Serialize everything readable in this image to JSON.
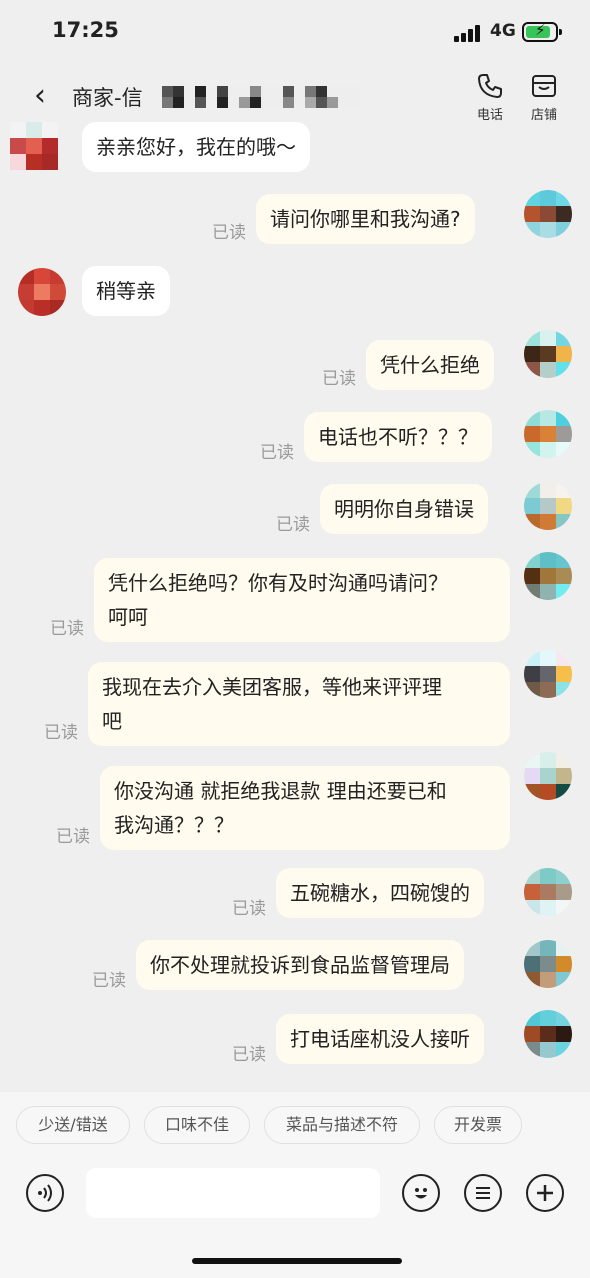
{
  "status": {
    "time": "17:25",
    "network": "4G"
  },
  "header": {
    "back_icon": "chevron-left-icon",
    "title": "商家-信",
    "phone_label": "电话",
    "store_label": "店铺"
  },
  "messages": [
    {
      "side": "in",
      "text": "亲亲您好，我在的哦～"
    },
    {
      "side": "out",
      "read": "已读",
      "text": "请问你哪里和我沟通?"
    },
    {
      "side": "in",
      "text": "稍等亲"
    },
    {
      "side": "out",
      "read": "已读",
      "text": "凭什么拒绝"
    },
    {
      "side": "out",
      "read": "已读",
      "text": "电话也不听？？？"
    },
    {
      "side": "out",
      "read": "已读",
      "text": "明明你自身错误"
    },
    {
      "side": "out",
      "read": "已读",
      "text": "凭什么拒绝吗？你有及时沟通吗请问？",
      "text2": "呵呵"
    },
    {
      "side": "out",
      "read": "已读",
      "text": "我现在去介入美团客服，等他来评评理",
      "text2": "吧"
    },
    {
      "side": "out",
      "read": "已读",
      "text": "你没沟通 就拒绝我退款 理由还要已和",
      "text2": "我沟通？？？"
    },
    {
      "side": "out",
      "read": "已读",
      "text": "五碗糖水，四碗馊的"
    },
    {
      "side": "out",
      "read": "已读",
      "text": "你不处理就投诉到食品监督管理局"
    },
    {
      "side": "out",
      "read": "已读",
      "text": "打电话座机没人接听"
    }
  ],
  "quick_replies": [
    "少送/错送",
    "口味不佳",
    "菜品与描述不符",
    "开发票"
  ],
  "input": {
    "placeholder": ""
  },
  "colors": {
    "outgoing_bubble": "#fffbee",
    "incoming_bubble": "#ffffff",
    "read_text": "#9a9a9a"
  }
}
